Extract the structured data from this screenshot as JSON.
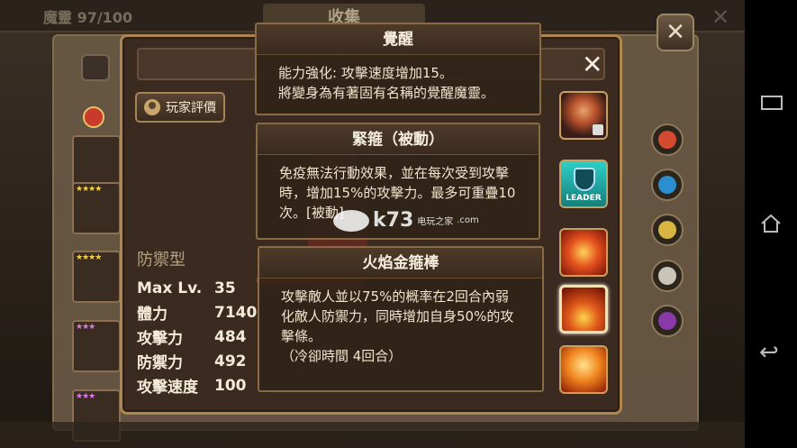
{
  "topbar": {
    "count": "魔靈 97/100",
    "title": "收集"
  },
  "main": {
    "close_glyph": "✕",
    "eval_button": "玩家評價"
  },
  "stats": {
    "type": "防禦型",
    "rows": [
      {
        "label": "Max Lv.",
        "value": "35"
      },
      {
        "label": "體力",
        "value": "7140"
      },
      {
        "label": "攻擊力",
        "value": "484"
      },
      {
        "label": "防禦力",
        "value": "492"
      },
      {
        "label": "攻擊速度",
        "value": "100"
      }
    ]
  },
  "panels": [
    {
      "title": "覺醒",
      "body": "能力強化: 攻擊速度增加15。\n將變身為有著固有名稱的覺醒魔靈。"
    },
    {
      "title": "緊箍（被動）",
      "body": "免疫無法行動效果，並在每次受到攻擊時，增加15%的攻擊力。最多可重疊10次。[被動]"
    },
    {
      "title": "火焰金箍棒",
      "body": "攻擊敵人並以75%的概率在2回合內弱化敵人防禦力，同時增加自身50%的攻擊條。\n（冷卻時間 4回合）"
    }
  ],
  "skills": {
    "leader_label": "LEADER"
  },
  "watermark": {
    "text": "k73",
    "sub": "电玩之家",
    "domain": ".com"
  },
  "outer_close": "✕",
  "colors": {
    "accent": "#b08650",
    "fire": "#e4521e",
    "leader": "#2dd0c8"
  },
  "icons": [
    "coins-icon",
    "fire-element-icon",
    "water-element-icon",
    "wind-element-icon",
    "light-element-icon",
    "dark-element-icon",
    "recent-apps-icon",
    "home-icon",
    "back-icon"
  ]
}
